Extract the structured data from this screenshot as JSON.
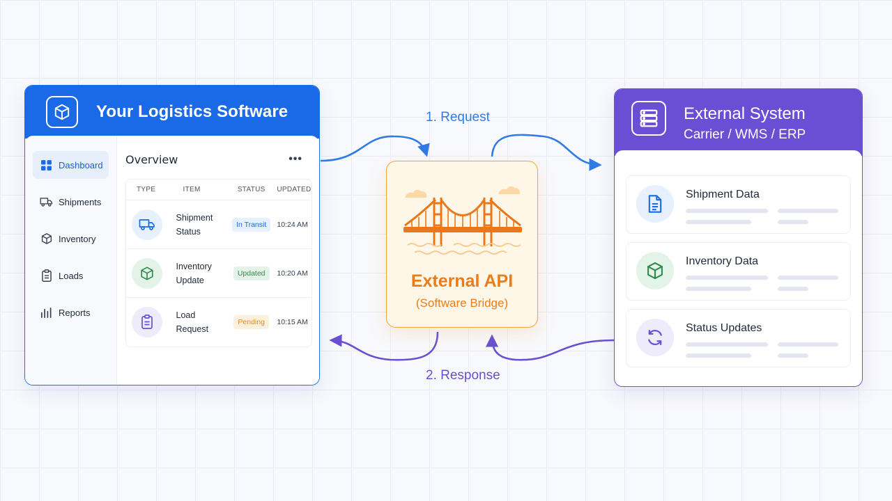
{
  "left_app": {
    "title": "Your Logistics Software",
    "logo_icon": "box-icon",
    "sidebar": [
      {
        "label": "Dashboard",
        "icon": "grid-icon",
        "active": true
      },
      {
        "label": "Shipments",
        "icon": "truck-icon",
        "active": false
      },
      {
        "label": "Inventory",
        "icon": "box-icon",
        "active": false
      },
      {
        "label": "Loads",
        "icon": "clipboard-icon",
        "active": false
      },
      {
        "label": "Reports",
        "icon": "bar-chart-icon",
        "active": false
      }
    ],
    "overview": {
      "title": "Overview",
      "more": "•••",
      "columns": [
        "TYPE",
        "ITEM",
        "STATUS",
        "UPDATED"
      ],
      "rows": [
        {
          "icon": "truck-icon",
          "item_line1": "Shipment",
          "item_line2": "Status",
          "status": "In Transit",
          "status_color": "#1a6ae8",
          "status_bg": "#e7f0fd",
          "updated": "10:24 AM"
        },
        {
          "icon": "box-icon",
          "item_line1": "Inventory",
          "item_line2": "Update",
          "status": "Updated",
          "status_color": "#2f8a4a",
          "status_bg": "#e4f3e8",
          "updated": "10:20 AM"
        },
        {
          "icon": "clipboard-icon",
          "item_line1": "Load",
          "item_line2": "Request",
          "status": "Pending",
          "status_color": "#e8871e",
          "status_bg": "#fdf1dd",
          "updated": "10:15 AM"
        }
      ]
    }
  },
  "bridge": {
    "title": "External API",
    "subtitle": "(Software Bridge)",
    "icon": "bridge-icon",
    "accent": "#ea7d1a"
  },
  "flows": {
    "request": "1. Request",
    "response": "2. Response",
    "request_color": "#2f7be6",
    "response_color": "#6a4fd0"
  },
  "external": {
    "title": "External System",
    "subtitle": "Carrier / WMS / ERP",
    "logo_icon": "server-icon",
    "items": [
      {
        "label": "Shipment Data",
        "icon": "document-icon"
      },
      {
        "label": "Inventory Data",
        "icon": "box-icon"
      },
      {
        "label": "Status Updates",
        "icon": "refresh-icon"
      }
    ]
  },
  "colors": {
    "primary_blue": "#1a6ae8",
    "purple": "#6a4fd4",
    "orange": "#ea7d1a"
  }
}
